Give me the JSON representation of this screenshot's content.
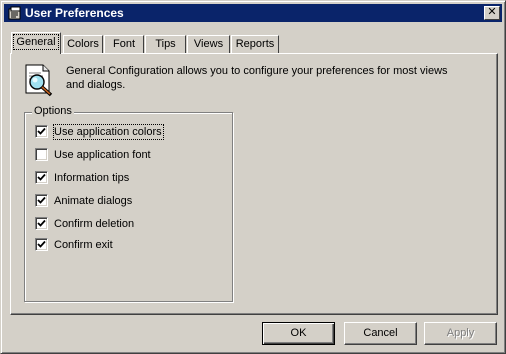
{
  "window": {
    "title": "User Preferences",
    "close_label": "✕"
  },
  "tabs": [
    {
      "label": "General",
      "active": true
    },
    {
      "label": "Colors",
      "active": false
    },
    {
      "label": "Font",
      "active": false
    },
    {
      "label": "Tips",
      "active": false
    },
    {
      "label": "Views",
      "active": false
    },
    {
      "label": "Reports",
      "active": false
    }
  ],
  "info": {
    "text": "General Configuration allows you to configure your preferences for most views and dialogs."
  },
  "options": {
    "label": "Options",
    "items": [
      {
        "label": "Use application colors",
        "checked": true
      },
      {
        "label": "Use application font",
        "checked": false
      },
      {
        "label": "Information tips",
        "checked": true
      },
      {
        "label": "Animate dialogs",
        "checked": true
      },
      {
        "label": "Confirm deletion",
        "checked": true
      },
      {
        "label": "Confirm exit",
        "checked": true
      }
    ]
  },
  "buttons": {
    "ok": "OK",
    "cancel": "Cancel",
    "apply": "Apply"
  }
}
